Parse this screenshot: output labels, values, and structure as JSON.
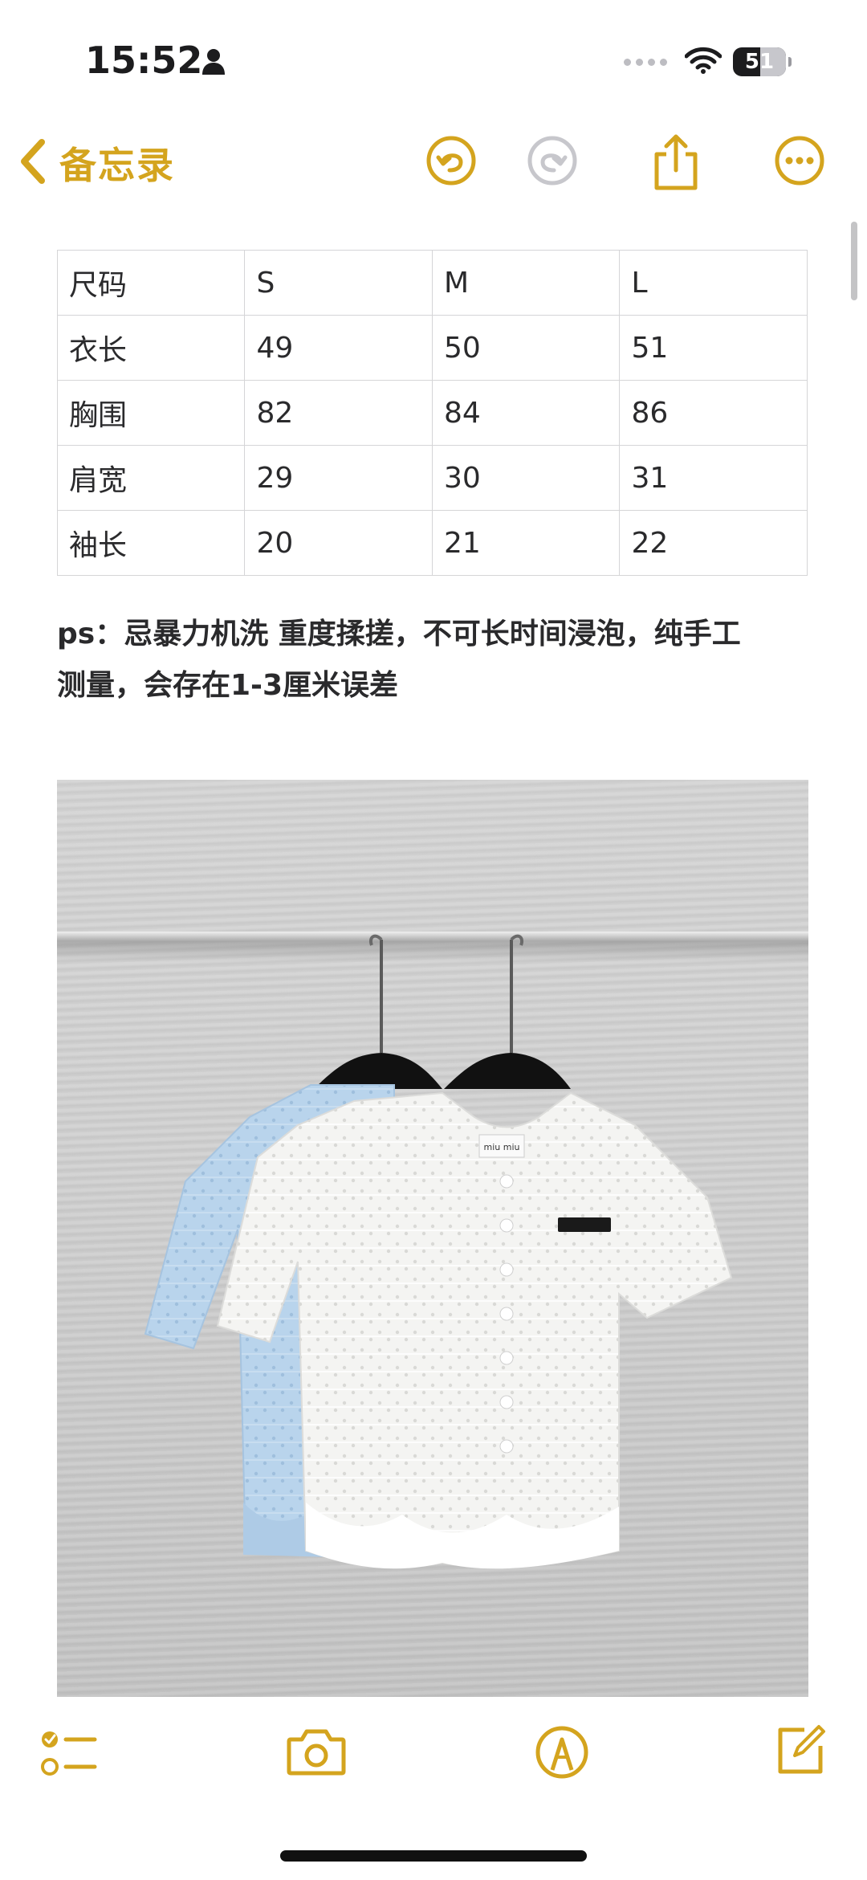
{
  "status_bar": {
    "time": "15:52",
    "battery": "51",
    "person_icon": "person-icon",
    "wifi_icon": "wifi-icon"
  },
  "nav": {
    "back_label": "备忘录",
    "accent_color": "#d4a41e",
    "icons": [
      "chevron-left-icon",
      "undo-icon",
      "redo-icon",
      "share-icon",
      "more-icon"
    ]
  },
  "table": {
    "rows": [
      [
        "尺码",
        "S",
        "M",
        "L"
      ],
      [
        "衣长",
        "49",
        "50",
        "51"
      ],
      [
        "胸围",
        "82",
        "84",
        "86"
      ],
      [
        "肩宽",
        "29",
        "30",
        "31"
      ],
      [
        "袖长",
        "20",
        "21",
        "22"
      ]
    ]
  },
  "note": {
    "line1": "ps：忌暴力机洗 重度揉搓，不可长时间浸泡，纯手工",
    "line2": "测量，会存在1-3厘米误差"
  },
  "photo": {
    "label_text": "miu miu"
  },
  "toolbar": {
    "icons": [
      "checklist-icon",
      "camera-icon",
      "markup-icon",
      "compose-icon"
    ]
  }
}
